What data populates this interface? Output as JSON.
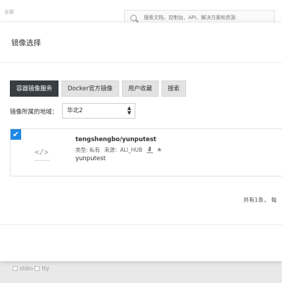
{
  "backdrop": {
    "crumb": "全部",
    "search_placeholder": "搜索文档、控制台、API、解决方案和资源",
    "options": [
      "stdin",
      "tty"
    ]
  },
  "modal": {
    "title": "镜像选择",
    "tabs": [
      {
        "label": "容器镜像服务",
        "active": true
      },
      {
        "label": "Docker官方镜像",
        "active": false
      },
      {
        "label": "用户收藏",
        "active": false
      },
      {
        "label": "搜索",
        "active": false
      }
    ],
    "region_label": "镜像所属的地域：",
    "region_value": "华北2",
    "results": [
      {
        "checked": true,
        "icon": "code-icon",
        "name": "tengshengbo/yunputest",
        "type_label": "类型: 私有",
        "source_label": "来源：ALI_HUB",
        "description": "yunputest"
      }
    ],
    "pagination": "共有1条， 每"
  },
  "colors": {
    "tab_active_bg": "#373d41",
    "checkbox_blue": "#1e88e5"
  }
}
